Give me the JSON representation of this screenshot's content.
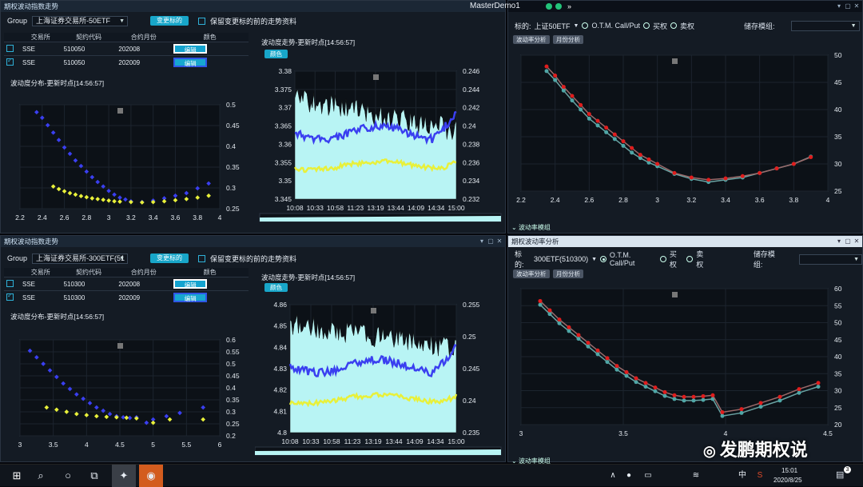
{
  "app": {
    "title": "MasterDemo1"
  },
  "panels": {
    "tl_title": "期权波动指数走势",
    "bl_title": "期权波动指数走势",
    "br_title": "期权波动率分析"
  },
  "top": {
    "group_label": "Group",
    "group_value": "上海证券交易所-50ETF",
    "change_btn": "变更标的",
    "keep_label": "保留变更标的前的走势资料",
    "headers": [
      "交易所",
      "契约代码",
      "合约月份",
      "颜色"
    ],
    "rows": [
      {
        "exchange": "SSE",
        "code": "510050",
        "month": "202008",
        "color_btn": "编辑",
        "checked": false
      },
      {
        "exchange": "SSE",
        "code": "510050",
        "month": "202009",
        "color_btn": "编辑",
        "checked": true
      }
    ],
    "dist_title": "波动度分布-更新时点[14:56:57]",
    "trend_title": "波动度走势-更新时点[14:56:57]",
    "color_btn": "颜色"
  },
  "bottom": {
    "group_label": "Group",
    "group_value": "上海证券交易所-300ETF(51",
    "change_btn": "变更标的",
    "keep_label": "保留变更标的前的走势资料",
    "headers": [
      "交易所",
      "契约代码",
      "合约月份",
      "颜色"
    ],
    "rows": [
      {
        "exchange": "SSE",
        "code": "510300",
        "month": "202008",
        "color_btn": "编辑",
        "checked": false
      },
      {
        "exchange": "SSE",
        "code": "510300",
        "month": "202009",
        "color_btn": "编辑",
        "checked": true
      }
    ],
    "dist_title": "波动度分布-更新时点[14:56:57]",
    "trend_title": "波动度走势-更新时点[14:56:57]",
    "color_btn": "颜色"
  },
  "right_top": {
    "target_label": "标的:",
    "target_value": "上证50ETF",
    "otm_label": "O.T.M. Call/Put",
    "buy_label": "买权",
    "sell_label": "卖权",
    "store_label": "储存模组:",
    "tab1": "波动率分析",
    "tab2": "月份分析",
    "footer": "波动率模组"
  },
  "right_bottom": {
    "target_label": "标的:",
    "target_value": "300ETF(510300)",
    "otm_label": "O.T.M. Call/Put",
    "buy_label": "买权",
    "sell_label": "卖权",
    "store_label": "储存模组:",
    "tab1": "波动率分析",
    "tab2": "月份分析",
    "footer": "波动率模组"
  },
  "watermark": "发鹏期权说",
  "taskbar": {
    "time": "15:01",
    "date": "2020/8/25",
    "ime": "中",
    "badge": "3"
  },
  "colors": {
    "blue": "#3a3ff0",
    "yellow": "#e8f03a",
    "cyan": "#b8f4f4",
    "red": "#e01d1d",
    "teal": "#4fa6a6"
  },
  "chart_data": [
    {
      "id": "tl_dist",
      "type": "scatter",
      "x_ticks": [
        "2.2",
        "2.4",
        "2.6",
        "2.8",
        "3",
        "3.2",
        "3.4",
        "3.6",
        "3.8",
        "4"
      ],
      "y_ticks": [
        "0.5",
        "0.45",
        "0.4",
        "0.35",
        "0.3",
        "0.25"
      ],
      "xlim": [
        2.2,
        4.0
      ],
      "ylim": [
        0.23,
        0.51
      ],
      "series": [
        {
          "color": "#3a3ff0",
          "points": [
            [
              2.35,
              0.49
            ],
            [
              2.4,
              0.475
            ],
            [
              2.45,
              0.455
            ],
            [
              2.5,
              0.435
            ],
            [
              2.55,
              0.415
            ],
            [
              2.6,
              0.395
            ],
            [
              2.65,
              0.378
            ],
            [
              2.7,
              0.36
            ],
            [
              2.75,
              0.345
            ],
            [
              2.8,
              0.33
            ],
            [
              2.85,
              0.315
            ],
            [
              2.9,
              0.302
            ],
            [
              2.95,
              0.29
            ],
            [
              3.0,
              0.278
            ],
            [
              3.05,
              0.268
            ],
            [
              3.1,
              0.26
            ],
            [
              3.15,
              0.255
            ],
            [
              3.2,
              0.25
            ],
            [
              3.3,
              0.248
            ],
            [
              3.4,
              0.252
            ],
            [
              3.5,
              0.258
            ],
            [
              3.6,
              0.265
            ],
            [
              3.7,
              0.272
            ],
            [
              3.8,
              0.285
            ],
            [
              3.9,
              0.298
            ]
          ]
        },
        {
          "color": "#e8f03a",
          "points": [
            [
              2.5,
              0.29
            ],
            [
              2.55,
              0.283
            ],
            [
              2.6,
              0.277
            ],
            [
              2.65,
              0.272
            ],
            [
              2.7,
              0.268
            ],
            [
              2.75,
              0.264
            ],
            [
              2.8,
              0.261
            ],
            [
              2.85,
              0.258
            ],
            [
              2.9,
              0.256
            ],
            [
              2.95,
              0.254
            ],
            [
              3.0,
              0.252
            ],
            [
              3.05,
              0.25
            ],
            [
              3.1,
              0.249
            ],
            [
              3.2,
              0.248
            ],
            [
              3.3,
              0.247
            ],
            [
              3.4,
              0.248
            ],
            [
              3.5,
              0.25
            ],
            [
              3.6,
              0.253
            ],
            [
              3.7,
              0.256
            ],
            [
              3.8,
              0.26
            ],
            [
              3.9,
              0.265
            ]
          ]
        }
      ]
    },
    {
      "id": "tl_trend",
      "type": "line",
      "x_ticks": [
        "10:08",
        "10:33",
        "10:58",
        "11:23",
        "13:19",
        "13:44",
        "14:09",
        "14:34",
        "15:00"
      ],
      "yl_ticks": [
        "3.38",
        "3.375",
        "3.37",
        "3.365",
        "3.36",
        "3.355",
        "3.35",
        "3.345"
      ],
      "yr_ticks": [
        "0.246",
        "0.244",
        "0.242",
        "0.24",
        "0.238",
        "0.236",
        "0.234",
        "0.232"
      ]
    },
    {
      "id": "tr_vol",
      "type": "line",
      "x_ticks": [
        "2.2",
        "2.4",
        "2.6",
        "2.8",
        "3",
        "3.2",
        "3.4",
        "3.6",
        "3.8",
        "4"
      ],
      "y_ticks": [
        "50",
        "45",
        "40",
        "35",
        "30",
        "25"
      ],
      "xlim": [
        2.2,
        4.0
      ],
      "ylim": [
        22,
        52
      ],
      "series": [
        {
          "color": "#e01d1d",
          "points": [
            [
              2.35,
              49.5
            ],
            [
              2.4,
              47.5
            ],
            [
              2.45,
              45
            ],
            [
              2.5,
              43
            ],
            [
              2.55,
              41
            ],
            [
              2.6,
              39
            ],
            [
              2.65,
              37.5
            ],
            [
              2.7,
              36
            ],
            [
              2.75,
              34.5
            ],
            [
              2.8,
              33
            ],
            [
              2.85,
              31.5
            ],
            [
              2.9,
              30
            ],
            [
              2.95,
              29
            ],
            [
              3.0,
              28
            ],
            [
              3.1,
              26
            ],
            [
              3.2,
              25
            ],
            [
              3.3,
              24.5
            ],
            [
              3.4,
              24.8
            ],
            [
              3.5,
              25.3
            ],
            [
              3.6,
              26
            ],
            [
              3.7,
              27
            ],
            [
              3.8,
              28
            ],
            [
              3.9,
              29.5
            ]
          ]
        },
        {
          "color": "#4fa6a6",
          "points": [
            [
              2.35,
              48.5
            ],
            [
              2.4,
              46.5
            ],
            [
              2.45,
              44.2
            ],
            [
              2.5,
              42
            ],
            [
              2.55,
              40
            ],
            [
              2.6,
              38
            ],
            [
              2.65,
              36.5
            ],
            [
              2.7,
              35
            ],
            [
              2.75,
              33.5
            ],
            [
              2.8,
              32
            ],
            [
              2.85,
              30.5
            ],
            [
              2.9,
              29.3
            ],
            [
              2.95,
              28.3
            ],
            [
              3.0,
              27.5
            ],
            [
              3.1,
              25.8
            ],
            [
              3.2,
              24.7
            ],
            [
              3.3,
              24
            ],
            [
              3.4,
              24.5
            ],
            [
              3.5,
              25
            ],
            [
              3.6,
              26
            ],
            [
              3.7,
              27
            ],
            [
              3.8,
              28
            ],
            [
              3.9,
              29.6
            ]
          ]
        }
      ]
    },
    {
      "id": "bl_dist",
      "type": "scatter",
      "x_ticks": [
        "3",
        "3.5",
        "4",
        "4.5",
        "5",
        "5.5",
        "6"
      ],
      "y_ticks": [
        "0.6",
        "0.55",
        "0.5",
        "0.45",
        "0.4",
        "0.35",
        "0.3",
        "0.25",
        "0.2"
      ],
      "xlim": [
        3.0,
        6.0
      ],
      "ylim": [
        0.18,
        0.62
      ]
    },
    {
      "id": "bl_trend",
      "type": "line",
      "x_ticks": [
        "10:08",
        "10:33",
        "10:58",
        "11:23",
        "13:19",
        "13:44",
        "14:09",
        "14:34",
        "15:00"
      ],
      "yl_ticks": [
        "4.86",
        "4.85",
        "4.84",
        "4.83",
        "4.82",
        "4.81",
        "4.8"
      ],
      "yr_ticks": [
        "0.255",
        "0.25",
        "0.245",
        "0.24",
        "0.235"
      ]
    },
    {
      "id": "br_vol",
      "type": "line",
      "x_ticks": [
        "3",
        "3.5",
        "4",
        "4.5"
      ],
      "y_ticks": [
        "60",
        "55",
        "50",
        "45",
        "40",
        "35",
        "30",
        "25",
        "20"
      ]
    }
  ]
}
